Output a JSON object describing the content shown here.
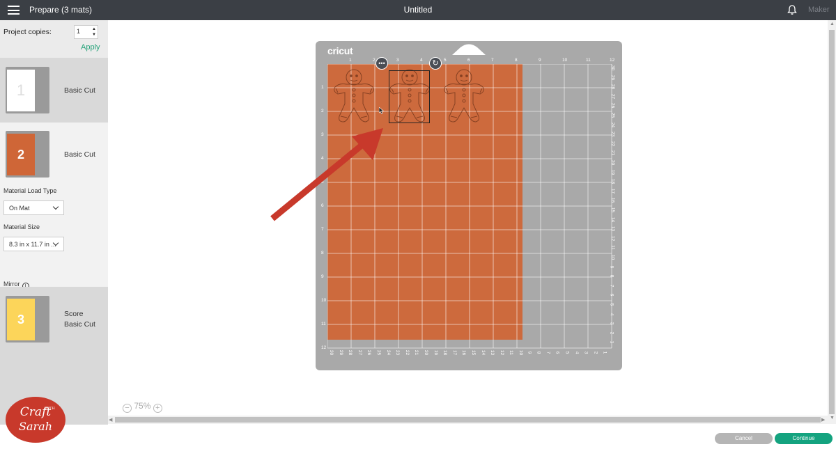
{
  "topbar": {
    "title": "Prepare (3 mats)",
    "document_title": "Untitled",
    "machine": "Maker",
    "menu_icon": "hamburger-menu-icon",
    "bell_icon": "bell-icon"
  },
  "sidebar": {
    "copies_label": "Project copies:",
    "copies_value": "1",
    "apply_label": "Apply",
    "mats": [
      {
        "number": "1",
        "label_line1": "Basic Cut",
        "label_line2": "",
        "color": "#ffffff"
      },
      {
        "number": "2",
        "label_line1": "Basic Cut",
        "label_line2": "",
        "color": "#cf6637"
      },
      {
        "number": "3",
        "label_line1": "Score",
        "label_line2": "Basic Cut",
        "color": "#fcd55a"
      }
    ],
    "material_load_type_label": "Material Load Type",
    "material_load_type_value": "On Mat",
    "material_size_label": "Material Size",
    "material_size_value": "8.3 in x 11.7 in ...",
    "mirror_label": "Mirror",
    "mirror_on": false
  },
  "logo": {
    "line1": "Craft",
    "with": "WITH",
    "line2": "Sarah"
  },
  "canvas": {
    "zoom_minus": "−",
    "zoom_level": "75%",
    "zoom_plus": "+",
    "mat_brand": "cricut",
    "mat_material_color": "#cf6637",
    "top_ticks": [
      "1",
      "2",
      "3",
      "4",
      "5",
      "6",
      "7",
      "8",
      "9",
      "10",
      "11",
      "12"
    ],
    "left_ticks": [
      "1",
      "2",
      "3",
      "4",
      "5",
      "6",
      "7",
      "8",
      "9",
      "10",
      "11",
      "12"
    ],
    "right_ticks": [
      "30",
      "29",
      "28",
      "27",
      "26",
      "25",
      "24",
      "23",
      "22",
      "21",
      "20",
      "19",
      "18",
      "17",
      "16",
      "15",
      "14",
      "13",
      "12",
      "11",
      "10",
      "9",
      "8",
      "7",
      "6",
      "5",
      "4",
      "3",
      "2",
      "1"
    ],
    "bottom_ticks": [
      "30",
      "29",
      "28",
      "27",
      "26",
      "25",
      "24",
      "23",
      "22",
      "21",
      "20",
      "19",
      "18",
      "17",
      "16",
      "15",
      "14",
      "13",
      "12",
      "11",
      "10",
      "9",
      "8",
      "7",
      "6",
      "5",
      "4",
      "3",
      "2",
      "1"
    ],
    "selection_more": "•••",
    "selection_rotate": "↻"
  },
  "footer": {
    "cancel_label": "Cancel",
    "continue_label": "Continue"
  },
  "colors": {
    "accent": "#14a37f",
    "topbar": "#3b3f45",
    "annotation_arrow": "#c8392b"
  }
}
